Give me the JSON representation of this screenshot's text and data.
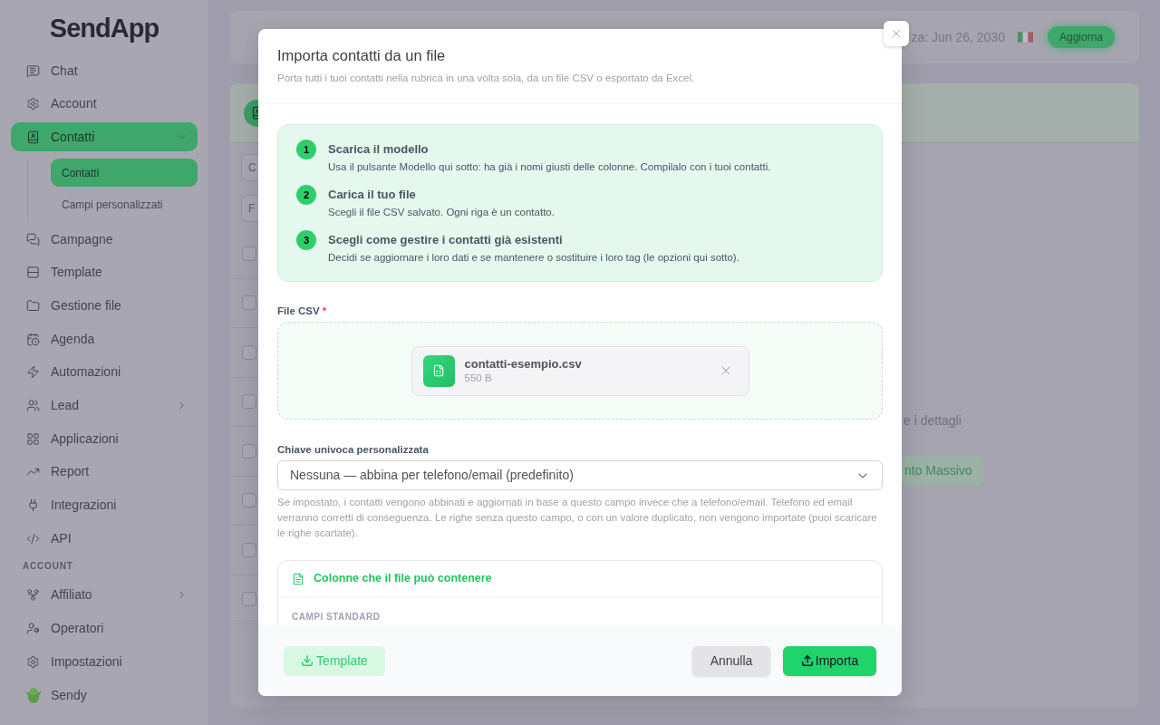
{
  "sidebar": {
    "logo": "SendApp",
    "groups": [
      {
        "items": [
          {
            "label": "Chat",
            "selected": false
          },
          {
            "label": "Account",
            "selected": false
          },
          {
            "label": "Contatti",
            "selected": true,
            "expanded": true,
            "children": [
              {
                "label": "Contatti",
                "selected": true
              },
              {
                "label": "Campi personalizzati",
                "selected": false
              }
            ]
          },
          {
            "label": "Campagne",
            "selected": false
          },
          {
            "label": "Template",
            "selected": false
          },
          {
            "label": "Gestione file",
            "selected": false
          },
          {
            "label": "Agenda",
            "selected": false
          },
          {
            "label": "Automazioni",
            "selected": false
          },
          {
            "label": "Lead",
            "selected": false,
            "expanded": false
          },
          {
            "label": "Applicazioni",
            "selected": false
          },
          {
            "label": "Report",
            "selected": false
          },
          {
            "label": "Integrazioni",
            "selected": false
          },
          {
            "label": "API",
            "selected": false
          }
        ]
      },
      {
        "heading": "ACCOUNT",
        "items": [
          {
            "label": "Affiliato",
            "selected": false,
            "expanded": false
          },
          {
            "label": "Operatori",
            "selected": false
          },
          {
            "label": "Impostazioni",
            "selected": false
          },
          {
            "label": "Sendy",
            "selected": false
          }
        ]
      }
    ]
  },
  "top_bar": {
    "status_text": "za: Jun 26, 2030",
    "upgrade_button": "Aggiorna"
  },
  "contacts_panel": {
    "fields": [
      {
        "placeholder": "C"
      },
      {
        "placeholder": "F"
      }
    ],
    "rows": [
      {
        "checked": false
      },
      {
        "checked": false
      },
      {
        "checked": false
      },
      {
        "checked": false
      },
      {
        "checked": false
      },
      {
        "checked": false
      },
      {
        "checked": false
      },
      {
        "checked": false
      }
    ],
    "side_text": "e i dettagli",
    "side_button": "nto Massivo"
  },
  "modal": {
    "title": "Importa contatti da un file",
    "subtitle": "Porta tutti i tuoi contatti nella rubrica in una volta sola, da un file CSV o esportato da Excel.",
    "steps": [
      {
        "number": "1",
        "title": "Scarica il modello",
        "description": "Usa il pulsante Modello qui sotto: ha già i nomi giusti delle colonne. Compilalo con i tuoi contatti."
      },
      {
        "number": "2",
        "title": "Carica il tuo file",
        "description": "Scegli il file CSV salvato. Ogni riga è un contatto."
      },
      {
        "number": "3",
        "title": "Scegli come gestire i contatti già esistenti",
        "description": "Decidi se aggiornare i loro dati e se mantenere o sostituire i loro tag (le opzioni qui sotto)."
      }
    ],
    "file_field": {
      "label": "File CSV",
      "required_mark": "*",
      "file": {
        "name": "contatti-esempio.csv",
        "size": "550 B"
      }
    },
    "unique_key": {
      "label": "Chiave univoca personalizzata",
      "value": "Nessuna — abbina per telefono/email (predefinito)",
      "help": "Se impostato, i contatti vengono abbinati e aggiornati in base a questo campo invece che a telefono/email. Telefono ed email verranno corretti di conseguenza. Le righe senza questo campo, o con un valore duplicato, non vengono importate (puoi scaricare le righe scartate)."
    },
    "columns_panel": {
      "title": "Colonne che il file può contenere",
      "section_heading": "CAMPI STANDARD"
    },
    "buttons": {
      "template": "Template",
      "cancel": "Annulla",
      "import": "Importa"
    }
  }
}
